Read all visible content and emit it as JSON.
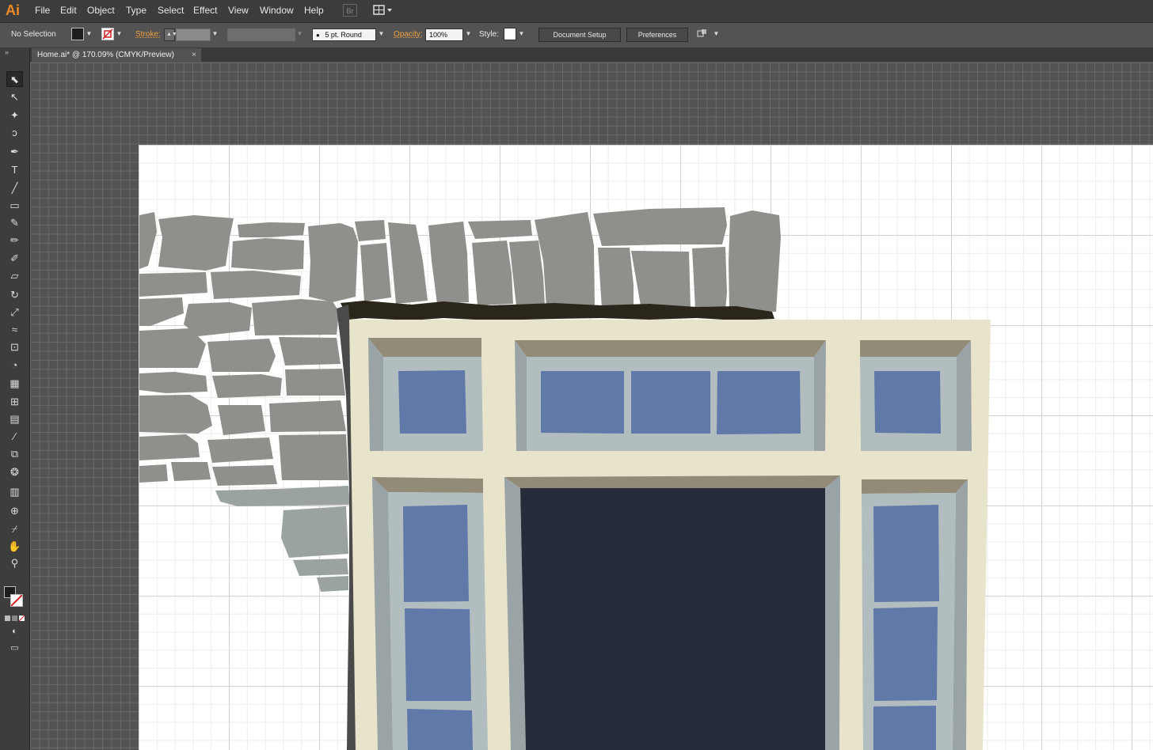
{
  "app": {
    "logo": "Ai"
  },
  "menu": [
    "File",
    "Edit",
    "Object",
    "Type",
    "Select",
    "Effect",
    "View",
    "Window",
    "Help"
  ],
  "bridge_label": "Br",
  "control": {
    "selection": "No Selection",
    "stroke_label": "Stroke:",
    "brush_profile": "5 pt. Round",
    "opacity_label": "Opacity:",
    "opacity_value": "100%",
    "style_label": "Style:",
    "document_setup": "Document Setup",
    "preferences": "Preferences"
  },
  "document": {
    "tab_title": "Home.ai* @ 170.09% (CMYK/Preview)",
    "close": "×"
  },
  "colors": {
    "fill": "#1e1e1e",
    "stroke": "none",
    "stone": "#8f908c",
    "stone_shadow": "#2b261b",
    "frame": "#e8e4cb",
    "frame_bevel": "#928b78",
    "glass_frame": "#b2bdc0",
    "glass": "#6079a8",
    "door": "#262c3a"
  },
  "tools": [
    "selection-tool",
    "direct-selection-tool",
    "magic-wand-tool",
    "lasso-tool",
    "pen-tool",
    "type-tool",
    "line-segment-tool",
    "rectangle-tool",
    "paintbrush-tool",
    "pencil-tool",
    "blob-brush-tool",
    "eraser-tool",
    "rotate-tool",
    "scale-tool",
    "warp-tool",
    "free-transform-tool",
    "shape-builder-tool",
    "perspective-grid-tool",
    "mesh-tool",
    "gradient-tool",
    "eyedropper-tool",
    "blend-tool",
    "symbol-sprayer-tool",
    "column-graph-tool",
    "artboard-tool",
    "slice-tool",
    "hand-tool",
    "zoom-tool"
  ]
}
